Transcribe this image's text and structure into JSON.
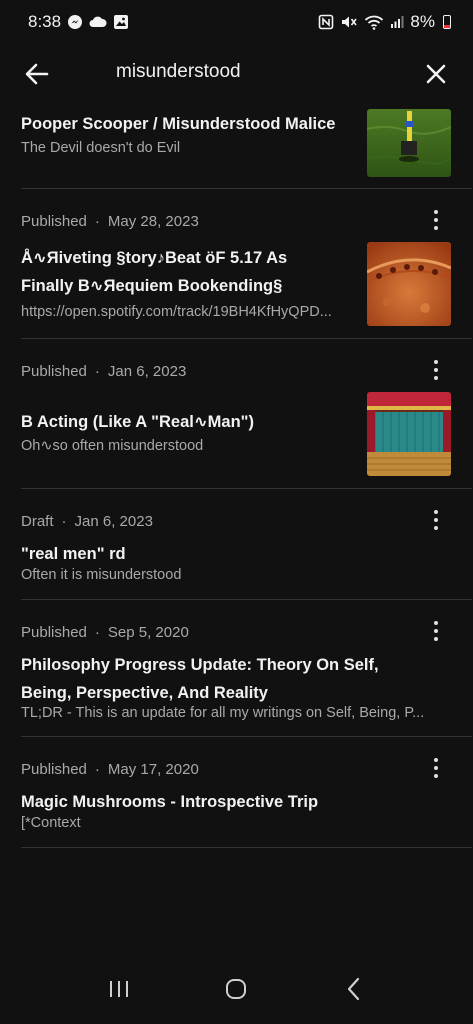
{
  "status": {
    "time": "8:38",
    "battery": "8%",
    "left_icons": [
      "messenger-icon",
      "cloud-icon",
      "gallery-icon"
    ],
    "right_icons": [
      "nfc-icon",
      "mute-icon",
      "wifi-icon",
      "signal-icon",
      "battery-icon"
    ]
  },
  "search": {
    "query": "misunderstood"
  },
  "posts": [
    {
      "status": "",
      "date": "",
      "title": "Pooper Scooper / Misunderstood Malice",
      "subtitle": "The Devil doesn't do Evil",
      "thumb": "lawn-scooper"
    },
    {
      "status": "Published",
      "date": "May 28, 2023",
      "title": "Å∿Яiveting §tory♪Beat öF 5.17 As Finally B∿Яequiem Bookending§",
      "subtitle": "https://open.spotify.com/track/19BH4KfHyQPD...",
      "thumb": "orange-texture"
    },
    {
      "status": "Published",
      "date": "Jan 6, 2023",
      "title": "B Acting (Like A \"Real∿Man\")",
      "subtitle": "Oh∿so often misunderstood",
      "thumb": "stage"
    },
    {
      "status": "Draft",
      "date": "Jan 6, 2023",
      "title": "\"real men\" rd",
      "subtitle": "Often it is misunderstood"
    },
    {
      "status": "Published",
      "date": "Sep 5, 2020",
      "title": "Philosophy Progress Update: Theory On Self, Being, Perspective, And Reality",
      "subtitle": "TL;DR - This is an update for all my writings on Self, Being, P..."
    },
    {
      "status": "Published",
      "date": "May 17, 2020",
      "title": "Magic Mushrooms - Introspective Trip",
      "subtitle": "[*Context"
    }
  ],
  "colors": {
    "background": "#111111",
    "divider": "#333333",
    "muted_text": "#a9a9a9"
  }
}
